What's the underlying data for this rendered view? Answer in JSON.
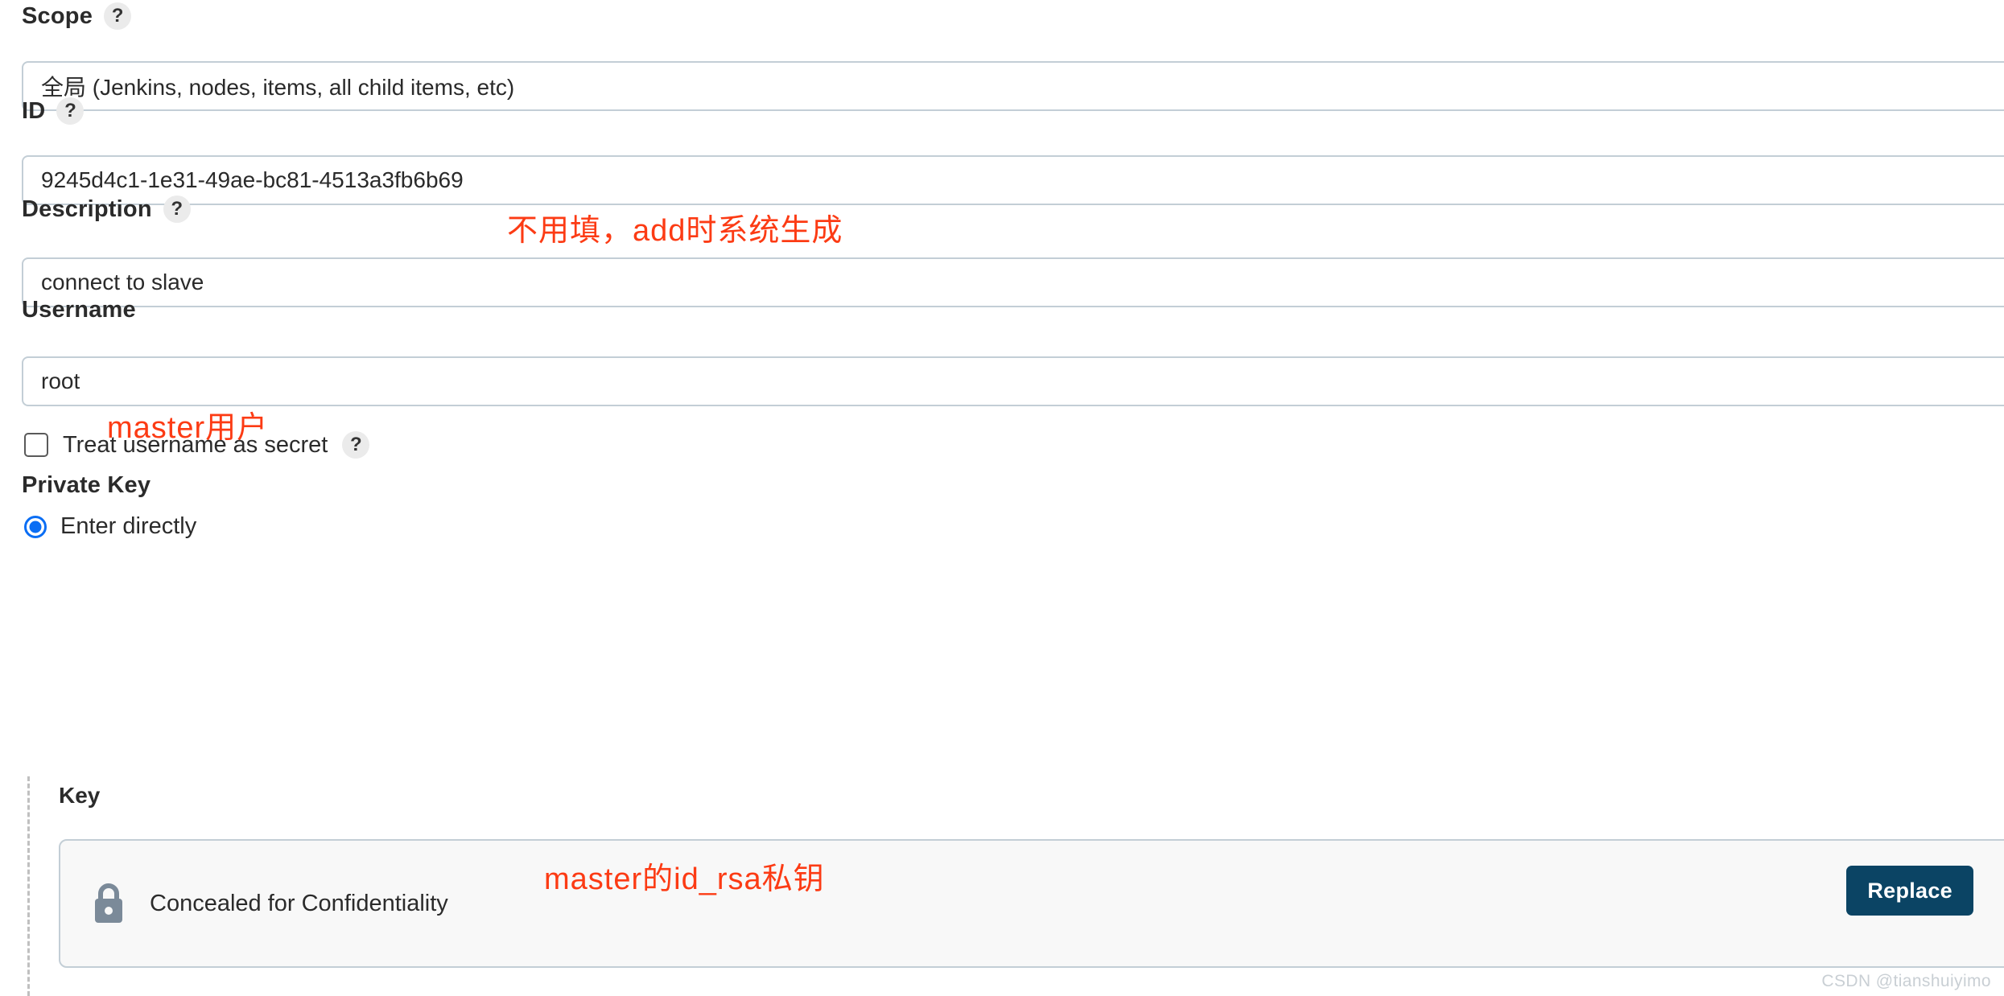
{
  "form": {
    "scope": {
      "label": "Scope",
      "help_icon": "help-question-icon",
      "value": "全局 (Jenkins, nodes, items, all child items, etc)"
    },
    "id": {
      "label": "ID",
      "help_icon": "help-question-icon",
      "value": "9245d4c1-1e31-49ae-bc81-4513a3fb6b69",
      "annotation": "不用填，add时系统生成"
    },
    "description": {
      "label": "Description",
      "help_icon": "help-question-icon",
      "value": "connect to slave"
    },
    "username": {
      "label": "Username",
      "value": "root",
      "annotation": "master用户"
    },
    "treat_username_as_secret": {
      "label": "Treat username as secret",
      "help_icon": "help-question-icon",
      "checked": false
    },
    "private_key": {
      "label": "Private Key",
      "option_enter_directly": "Enter directly",
      "key_label": "Key",
      "concealed_text": "Concealed for Confidentiality",
      "lock_icon": "lock-icon",
      "replace_button": "Replace",
      "annotation": "master的id_rsa私钥"
    }
  },
  "watermark": "CSDN @tianshuiyimo",
  "colors": {
    "accent_blue": "#0b6ef4",
    "button_navy": "#0b4464",
    "annotation_red": "#fc3b14",
    "field_border": "#c3ced6",
    "lock_gray": "#7b8a99"
  }
}
